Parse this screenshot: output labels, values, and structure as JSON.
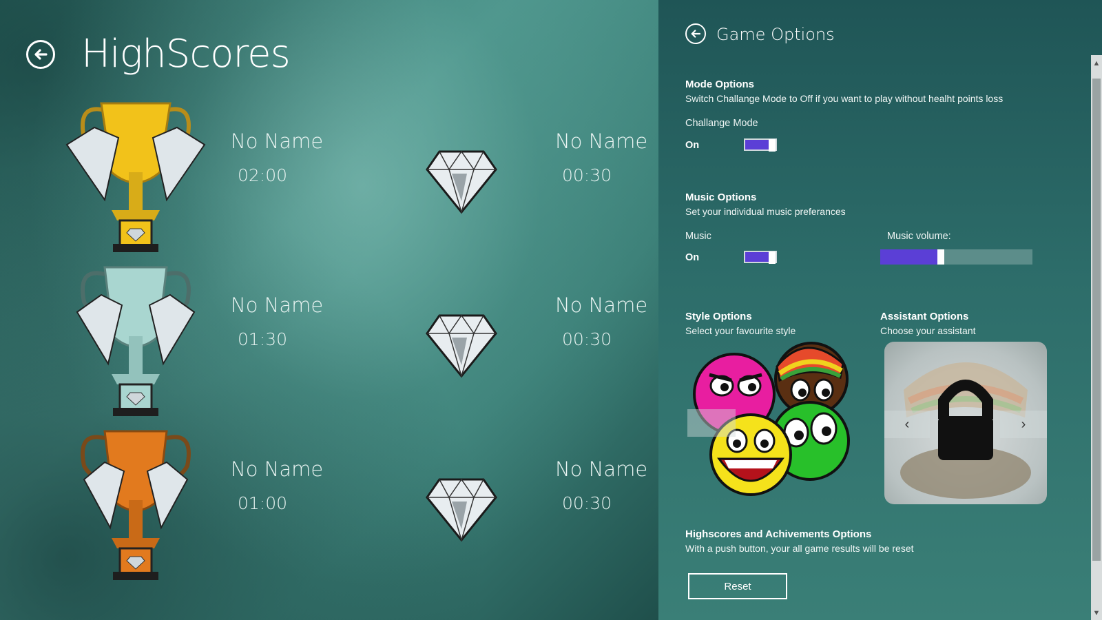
{
  "highscores": {
    "title": "HighScores",
    "left_entries": [
      {
        "name": "No Name",
        "time": "02:00",
        "trophy": "gold"
      },
      {
        "name": "No Name",
        "time": "01:30",
        "trophy": "silver"
      },
      {
        "name": "No Name",
        "time": "01:00",
        "trophy": "bronze"
      }
    ],
    "right_entries": [
      {
        "name": "No Name",
        "time": "00:30"
      },
      {
        "name": "No Name",
        "time": "00:30"
      },
      {
        "name": "No Name",
        "time": "00:30"
      }
    ]
  },
  "options": {
    "title": "Game Options",
    "mode": {
      "title": "Mode Options",
      "desc": "Switch Challange Mode to Off if you want to play without healht points loss",
      "label": "Challange Mode",
      "state": "On"
    },
    "music": {
      "title": "Music Options",
      "desc": "Set your individual music preferances",
      "label": "Music",
      "state": "On",
      "volume_label": "Music volume:",
      "volume_fraction": 0.4
    },
    "style": {
      "title": "Style Options",
      "desc": "Select your favourite style"
    },
    "assistant": {
      "title": "Assistant Options",
      "desc": "Choose your assistant",
      "prev_glyph": "‹",
      "next_glyph": "›"
    },
    "highscores": {
      "title": "Highscores and Achivements Options",
      "desc": "With a push button, your all game results will be reset",
      "reset_label": "Reset"
    }
  },
  "colors": {
    "toggle_on": "#5b3fd6",
    "gold": "#f2c21a",
    "silver": "#a9d6d0",
    "bronze": "#e27a1e"
  }
}
